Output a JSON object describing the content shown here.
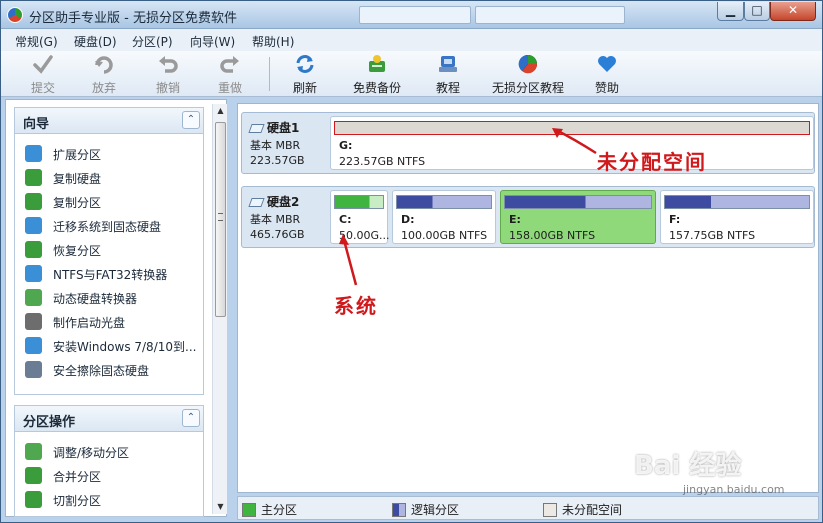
{
  "window": {
    "title": "分区助手专业版 - 无损分区免费软件",
    "controls": {
      "minimize": "▁",
      "maximize": "□",
      "close": "✕"
    }
  },
  "menu": [
    {
      "label": "常规(G)"
    },
    {
      "label": "硬盘(D)"
    },
    {
      "label": "分区(P)"
    },
    {
      "label": "向导(W)"
    },
    {
      "label": "帮助(H)"
    }
  ],
  "toolbar": {
    "commit": {
      "label": "提交",
      "icon": "check-icon"
    },
    "discard": {
      "label": "放弃",
      "icon": "discard-icon"
    },
    "undo": {
      "label": "撤销",
      "icon": "undo-icon"
    },
    "redo": {
      "label": "重做",
      "icon": "redo-icon"
    },
    "refresh": {
      "label": "刷新",
      "icon": "refresh-icon"
    },
    "backup": {
      "label": "免费备份",
      "icon": "backup-icon"
    },
    "tutorial": {
      "label": "教程",
      "icon": "tutorial-icon"
    },
    "lossless_tutorial": {
      "label": "无损分区教程",
      "icon": "lossless-tutorial-icon"
    },
    "donate": {
      "label": "赞助",
      "icon": "heart-icon"
    }
  },
  "wizard": {
    "title": "向导",
    "collapse_glyph": "⌃",
    "items": [
      {
        "label": "扩展分区",
        "icon": "extend-partition-icon",
        "color": "#3a8fd6"
      },
      {
        "label": "复制硬盘",
        "icon": "copy-disk-icon",
        "color": "#3b9c3b"
      },
      {
        "label": "复制分区",
        "icon": "copy-partition-icon",
        "color": "#3b9c3b"
      },
      {
        "label": "迁移系统到固态硬盘",
        "icon": "migrate-ssd-icon",
        "color": "#3a8fd6"
      },
      {
        "label": "恢复分区",
        "icon": "recover-partition-icon",
        "color": "#3b9c3b"
      },
      {
        "label": "NTFS与FAT32转换器",
        "icon": "ntfs-fat32-icon",
        "color": "#3a8fd6"
      },
      {
        "label": "动态硬盘转换器",
        "icon": "dynamic-disk-icon",
        "color": "#4fa84f"
      },
      {
        "label": "制作启动光盘",
        "icon": "boot-disc-icon",
        "color": "#6d6d6d"
      },
      {
        "label": "安装Windows 7/8/10到...",
        "icon": "install-windows-icon",
        "color": "#3a8fd6"
      },
      {
        "label": "安全擦除固态硬盘",
        "icon": "wipe-ssd-icon",
        "color": "#6b7d95"
      }
    ]
  },
  "partition_ops": {
    "title": "分区操作",
    "collapse_glyph": "⌃",
    "items": [
      {
        "label": "调整/移动分区",
        "icon": "resize-partition-icon",
        "color": "#4fa84f"
      },
      {
        "label": "合并分区",
        "icon": "merge-partition-icon",
        "color": "#3b9c3b"
      },
      {
        "label": "切割分区",
        "icon": "split-partition-icon",
        "color": "#3b9c3b"
      }
    ]
  },
  "disks": [
    {
      "name": "硬盘1",
      "type": "基本 MBR",
      "size": "223.57GB",
      "partitions": [
        {
          "letter": "G:",
          "info": "223.57GB NTFS",
          "kind": "unallocated",
          "used_fraction": 1.0
        }
      ]
    },
    {
      "name": "硬盘2",
      "type": "基本 MBR",
      "size": "465.76GB",
      "partitions": [
        {
          "letter": "C:",
          "info": "50.00G...",
          "kind": "primary",
          "used_fraction": 0.72
        },
        {
          "letter": "D:",
          "info": "100.00GB NTFS",
          "kind": "logical",
          "used_fraction": 0.38
        },
        {
          "letter": "E:",
          "info": "158.00GB NTFS",
          "kind": "logical",
          "used_fraction": 0.55,
          "selected": true
        },
        {
          "letter": "F:",
          "info": "157.75GB NTFS",
          "kind": "logical",
          "used_fraction": 0.32
        }
      ]
    }
  ],
  "annotations": {
    "unallocated": "未分配空间",
    "system": "系统"
  },
  "legend": {
    "primary": {
      "label": "主分区",
      "color": "#3fb53f"
    },
    "logical": {
      "label": "逻辑分区",
      "color": "#4a4fa6"
    },
    "unallocated": {
      "label": "未分配空间",
      "color": "#ece9e4"
    }
  },
  "colors": {
    "primary_fill": "#3fb53f",
    "logical_fill": "#3d4ba1",
    "logical_free": "#aeb5e0",
    "unallocated": "#dcd8d2",
    "selected_bg": "#8fd97a",
    "annotation_red": "#d0191c"
  },
  "watermark": {
    "brand": "Bai 经验",
    "url": "jingyan.baidu.com"
  }
}
